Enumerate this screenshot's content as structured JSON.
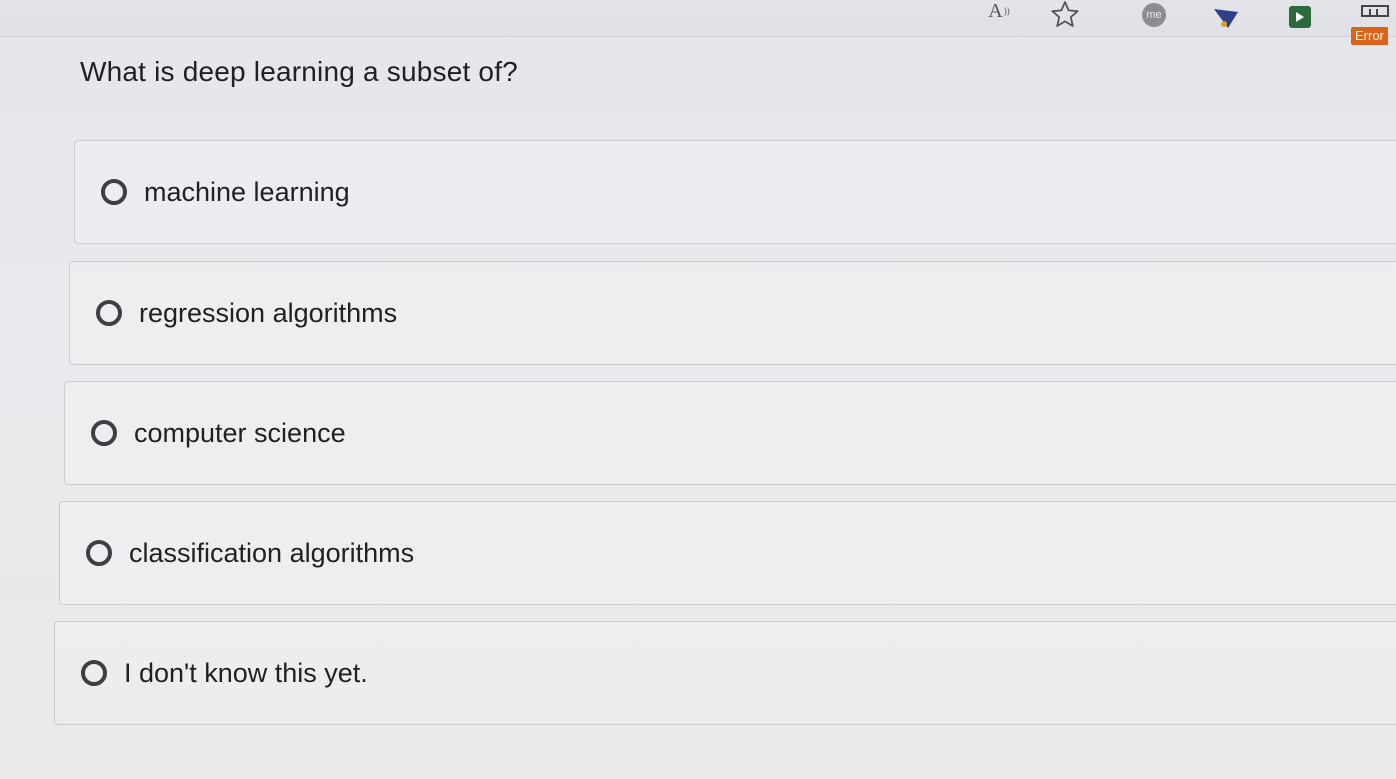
{
  "toolbar": {
    "icons": [
      "text-size-icon",
      "star-icon",
      "avatar-icon",
      "extension-icon",
      "extension-green-icon",
      "extension-menu-icon"
    ],
    "avatar_text": "me",
    "error_badge": "Error"
  },
  "quiz": {
    "question": "What is deep learning a subset of?",
    "options": [
      {
        "label": "machine learning"
      },
      {
        "label": "regression algorithms"
      },
      {
        "label": "computer science"
      },
      {
        "label": "classification algorithms"
      },
      {
        "label": "I don't know this yet."
      }
    ]
  },
  "colors": {
    "radio_border": "#3c3f44",
    "error_badge": "#d9651a",
    "extension_green": "#2d6b3e"
  }
}
